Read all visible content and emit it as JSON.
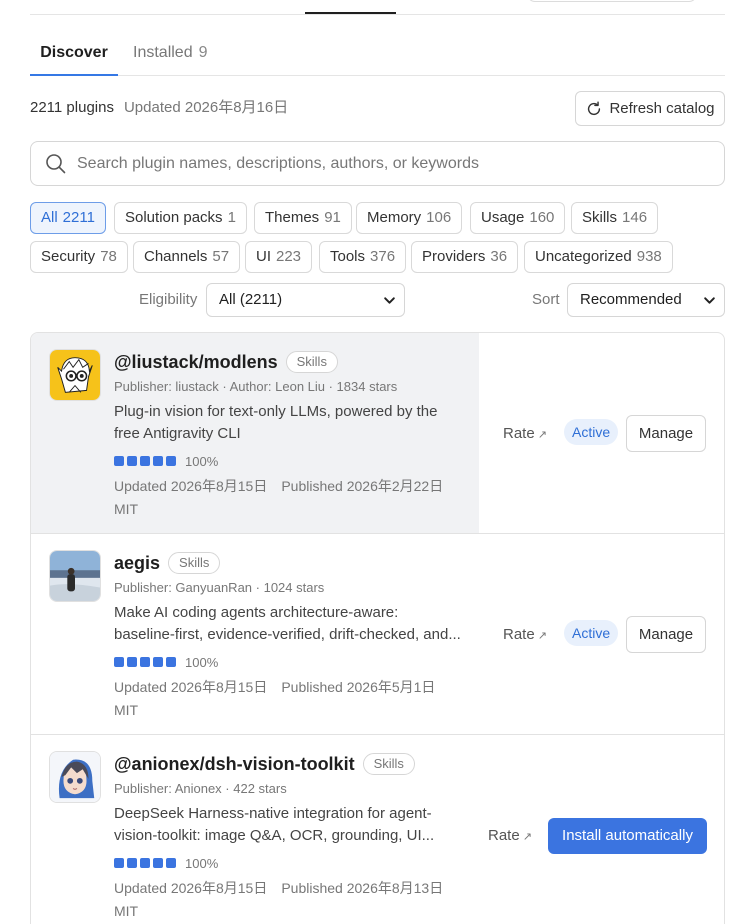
{
  "tabs": [
    {
      "label": "Discover",
      "count": ""
    },
    {
      "label": "Installed",
      "count": "9"
    }
  ],
  "summary": {
    "count_text": "2211 plugins",
    "updated_text": "Updated 2026年8月16日"
  },
  "refresh_label": "Refresh catalog",
  "search": {
    "placeholder": "Search plugin names, descriptions, authors, or keywords"
  },
  "chips": [
    {
      "label": "All",
      "count": "2211"
    },
    {
      "label": "Solution packs",
      "count": "1"
    },
    {
      "label": "Themes",
      "count": "91"
    },
    {
      "label": "Memory",
      "count": "106"
    },
    {
      "label": "Usage",
      "count": "160"
    },
    {
      "label": "Skills",
      "count": "146"
    },
    {
      "label": "Security",
      "count": "78"
    },
    {
      "label": "Channels",
      "count": "57"
    },
    {
      "label": "UI",
      "count": "223"
    },
    {
      "label": "Tools",
      "count": "376"
    },
    {
      "label": "Providers",
      "count": "36"
    },
    {
      "label": "Uncategorized",
      "count": "938"
    }
  ],
  "filters": {
    "eligibility_label": "Eligibility",
    "eligibility_value": "All (2211)",
    "sort_label": "Sort",
    "sort_value": "Recommended"
  },
  "plugins": [
    {
      "name": "@liustack/modlens",
      "tag": "Skills",
      "meta": "Publisher: liustack · Author: Leon Liu · 1834 stars",
      "desc_line1": "Plug-in vision for text-only LLMs, powered by the",
      "desc_line2": "free Antigravity CLI",
      "rating": "100%",
      "updated": "Updated 2026年8月15日",
      "published": "Published 2026年2月22日",
      "license": "MIT",
      "rate_label": "Rate",
      "status": "Active",
      "action": "Manage"
    },
    {
      "name": "aegis",
      "tag": "Skills",
      "meta": "Publisher: GanyuanRan · 1024 stars",
      "desc_line1": "Make AI coding agents architecture-aware:",
      "desc_line2": "baseline-first, evidence-verified, drift-checked, and...",
      "rating": "100%",
      "updated": "Updated 2026年8月15日",
      "published": "Published 2026年5月1日",
      "license": "MIT",
      "rate_label": "Rate",
      "status": "Active",
      "action": "Manage"
    },
    {
      "name": "@anionex/dsh-vision-toolkit",
      "tag": "Skills",
      "meta": "Publisher: Anionex · 422 stars",
      "desc_line1": "DeepSeek Harness-native integration for agent-",
      "desc_line2": "vision-toolkit: image Q&A, OCR, grounding, UI...",
      "rating": "100%",
      "updated": "Updated 2026年8月15日",
      "published": "Published 2026年8月13日",
      "license": "MIT",
      "rate_label": "Rate",
      "status": "",
      "action": "Install automatically"
    }
  ],
  "colors": {
    "accent": "#3b74e0",
    "active_badge_bg": "#e8f0fc",
    "highlight_row": "#f1f2f4"
  },
  "icons": {
    "refresh": "refresh-icon",
    "search": "search-icon",
    "select": "chevron-down-icon",
    "external": "arrow-up-right-icon"
  }
}
